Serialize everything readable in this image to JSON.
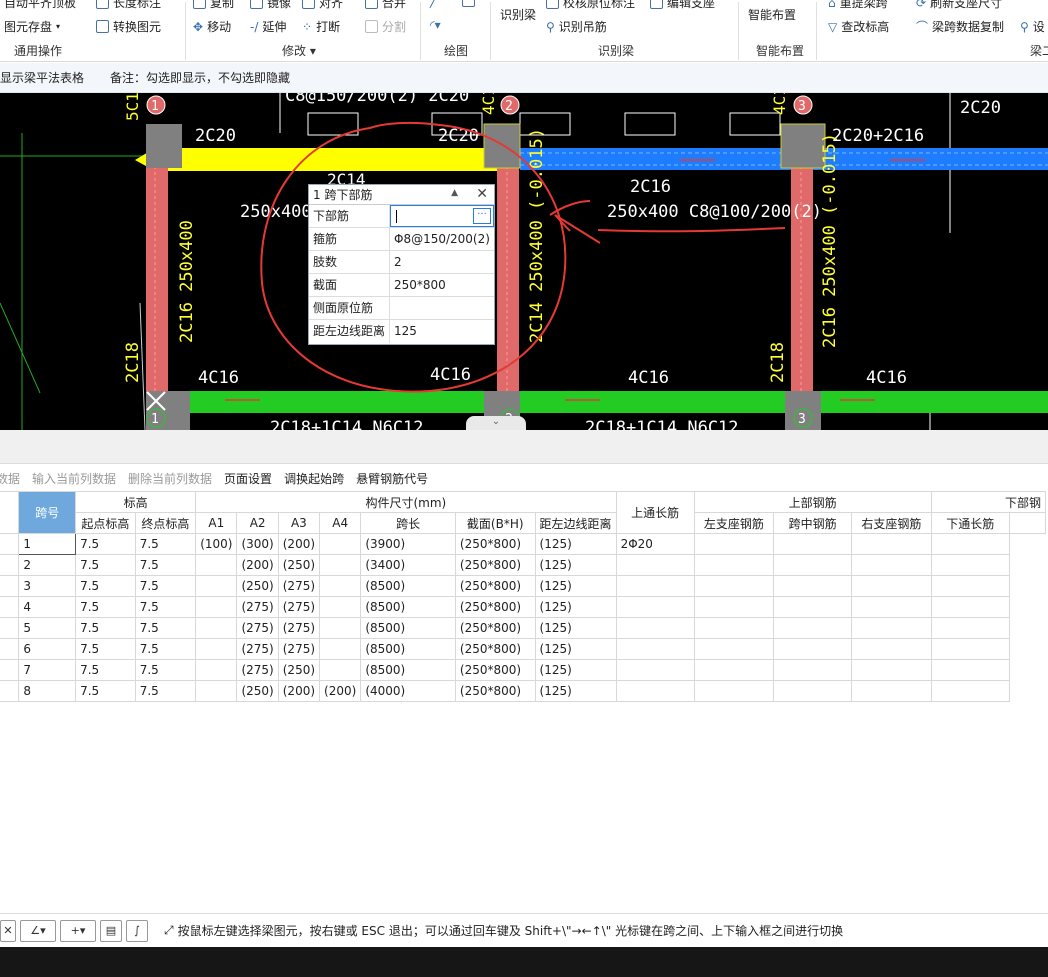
{
  "ribbon": {
    "groups": [
      {
        "label": "通用操作",
        "items": [
          {
            "label": "自动平齐顶板"
          },
          {
            "label": "长度标注"
          },
          {
            "label": "图元存盘"
          },
          {
            "label": "转换图元"
          }
        ]
      },
      {
        "label": "修改",
        "items": [
          {
            "label": "复制"
          },
          {
            "label": "镜像"
          },
          {
            "label": "对齐"
          },
          {
            "label": "合并"
          },
          {
            "label": "移动"
          },
          {
            "label": "延伸"
          },
          {
            "label": "打断"
          },
          {
            "label": "分割"
          }
        ]
      },
      {
        "label": "绘图",
        "items": []
      },
      {
        "label": "识别梁",
        "items": [
          {
            "label": "识别梁"
          },
          {
            "label": "校核原位标注"
          },
          {
            "label": "编辑支座"
          },
          {
            "label": "识别吊筋"
          }
        ]
      },
      {
        "label": "智能布置",
        "items": [
          {
            "label": "智能布置"
          }
        ]
      },
      {
        "label": "梁二",
        "items": [
          {
            "label": "重提梁跨"
          },
          {
            "label": "刷新支座尺寸"
          },
          {
            "label": "查改标高"
          },
          {
            "label": "梁跨数据复制"
          },
          {
            "label": "设"
          }
        ]
      }
    ]
  },
  "infobar": {
    "show_table": "显示梁平法表格",
    "note": "备注：勾选即显示，不勾选即隐藏"
  },
  "cad": {
    "top_text": "C8@150/200(2) 2C20",
    "labels": {
      "a1": "2C20",
      "a2": "2C20",
      "a3": "2C20+2C16",
      "a4": "2C20",
      "b1": "2C14",
      "b2": "2C16",
      "s1": "250x400",
      "s2": "250x400  C8@100/200(2)",
      "v1": "2C16 250x400",
      "v2": "2C14 250x400 (-0.015)",
      "v3": "2C16 250x400 (-0.015)",
      "v4": "2C18",
      "v5": "2C18",
      "v6": "5C1",
      "v7": "4C1",
      "v8": "4C1",
      "c1": "4C16",
      "c2": "4C16",
      "c3": "4C16",
      "c4": "4C16",
      "bot1": "2C18+1C14  N6C12",
      "bot2": "2C18+1C14  N6C12"
    },
    "axis": [
      "1",
      "2",
      "3",
      "1",
      "2",
      "3"
    ]
  },
  "popup": {
    "title": "1 跨下部筋",
    "rows": [
      {
        "key": "下部筋",
        "value": ""
      },
      {
        "key": "箍筋",
        "value": "Φ8@150/200(2)"
      },
      {
        "key": "肢数",
        "value": "2"
      },
      {
        "key": "截面",
        "value": "250*800"
      },
      {
        "key": "侧面原位筋",
        "value": ""
      },
      {
        "key": "距左边线距离",
        "value": "125"
      }
    ]
  },
  "toolbar": {
    "items": [
      {
        "label": "复制跨数据",
        "disabled": true
      },
      {
        "label": "输入当前列数据",
        "disabled": true
      },
      {
        "label": "删除当前列数据",
        "disabled": true
      },
      {
        "label": "页面设置",
        "disabled": false
      },
      {
        "label": "调换起始跨",
        "disabled": false
      },
      {
        "label": "悬臂钢筋代号",
        "disabled": false
      }
    ]
  },
  "grid": {
    "group_headers": {
      "kua": "跨号",
      "biaogao": "标高",
      "size": "构件尺寸(mm)",
      "top_through": "上通长筋",
      "top_rebar": "上部钢筋",
      "bottom_rebar": "下部钢"
    },
    "sub_headers": [
      "起点标高",
      "终点标高",
      "A1",
      "A2",
      "A3",
      "A4",
      "跨长",
      "截面(B*H)",
      "距左边线距离",
      "左支座钢筋",
      "跨中钢筋",
      "右支座钢筋",
      "下通长筋"
    ],
    "rows": [
      [
        "1",
        "7.5",
        "7.5",
        "(100)",
        "(300)",
        "(200)",
        "",
        "(3900)",
        "(250*800)",
        "(125)",
        "2Φ20",
        "",
        "",
        "",
        ""
      ],
      [
        "2",
        "7.5",
        "7.5",
        "",
        "(200)",
        "(250)",
        "",
        "(3400)",
        "(250*800)",
        "(125)",
        "",
        "",
        "",
        "",
        ""
      ],
      [
        "3",
        "7.5",
        "7.5",
        "",
        "(250)",
        "(275)",
        "",
        "(8500)",
        "(250*800)",
        "(125)",
        "",
        "",
        "",
        "",
        ""
      ],
      [
        "4",
        "7.5",
        "7.5",
        "",
        "(275)",
        "(275)",
        "",
        "(8500)",
        "(250*800)",
        "(125)",
        "",
        "",
        "",
        "",
        ""
      ],
      [
        "5",
        "7.5",
        "7.5",
        "",
        "(275)",
        "(275)",
        "",
        "(8500)",
        "(250*800)",
        "(125)",
        "",
        "",
        "",
        "",
        ""
      ],
      [
        "6",
        "7.5",
        "7.5",
        "",
        "(275)",
        "(275)",
        "",
        "(8500)",
        "(250*800)",
        "(125)",
        "",
        "",
        "",
        "",
        ""
      ],
      [
        "7",
        "7.5",
        "7.5",
        "",
        "(275)",
        "(250)",
        "",
        "(8500)",
        "(250*800)",
        "(125)",
        "",
        "",
        "",
        "",
        ""
      ],
      [
        "8",
        "7.5",
        "7.5",
        "",
        "(250)",
        "(200)",
        "(200)",
        "(4000)",
        "(250*800)",
        "(125)",
        "",
        "",
        "",
        "",
        ""
      ]
    ]
  },
  "status": {
    "hint": "按鼠标左键选择梁图元，按右键或 ESC 退出；可以通过回车键及 Shift+\\\"→←↑\\\" 光标键在跨之间、上下输入框之间进行切换"
  },
  "colors": {
    "accent": "#6fa8dc",
    "beam_yellow": "#ffff00",
    "beam_green": "#22cc22",
    "beam_blue": "#1e7cff",
    "column_red": "#e06a6a",
    "annotation_red": "#e53935"
  }
}
